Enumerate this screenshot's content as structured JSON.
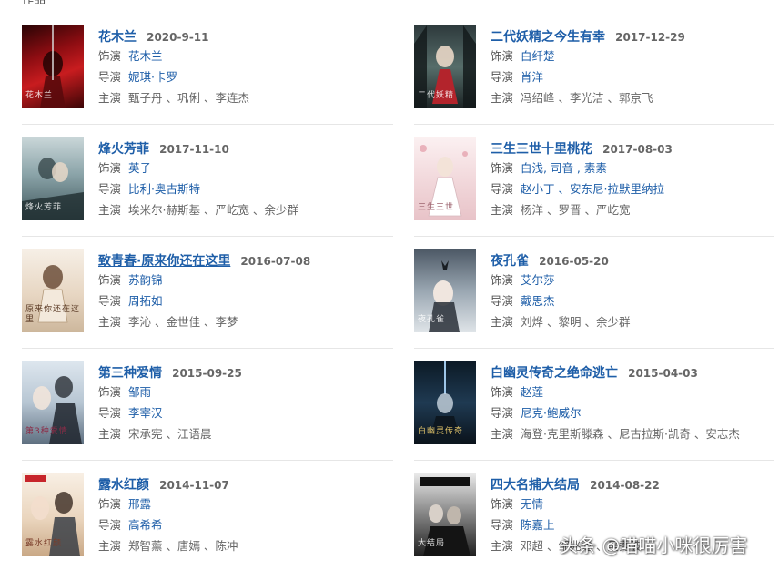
{
  "page": {
    "top_label": "作品"
  },
  "labels": {
    "role": "饰演",
    "director": "导演",
    "cast": "主演"
  },
  "colors": {
    "link": "#1e5ea8",
    "text": "#666666",
    "divider": "#e6e6e6"
  },
  "movies": [
    {
      "title": "花木兰",
      "date": "2020-9-11",
      "role": "花木兰",
      "director": "妮琪·卡罗",
      "cast": "甄子丹 、巩俐 、李连杰",
      "poster_icon": "poster-mulan",
      "poster_text": "花木兰"
    },
    {
      "title": "二代妖精之今生有幸",
      "date": "2017-12-29",
      "role": "白纤楚",
      "director": "肖洋",
      "cast": "冯绍峰 、李光洁 、郭京飞",
      "poster_icon": "poster-hanson",
      "poster_text": "二代妖精"
    },
    {
      "title": "烽火芳菲",
      "date": "2017-11-10",
      "role": "英子",
      "director": "比利·奥古斯特",
      "cast": "埃米尔·赫斯基 、严屹宽 、余少群",
      "poster_icon": "poster-fenghuo",
      "poster_text": "烽火芳菲"
    },
    {
      "title": "三生三世十里桃花",
      "date": "2017-08-03",
      "role": "白浅, 司音 , 素素",
      "director": "赵小丁 、安东尼·拉默里纳拉",
      "cast": "杨洋 、罗晋 、严屹宽",
      "poster_icon": "poster-sansheng",
      "poster_text": "三生三世"
    },
    {
      "title": "致青春·原来你还在这里",
      "date": "2016-07-08",
      "role": "苏韵锦",
      "director": "周拓如",
      "cast": "李沁 、金世佳 、李梦",
      "poster_icon": "poster-zhiqingchun",
      "poster_text": "原来你还在这里"
    },
    {
      "title": "夜孔雀",
      "date": "2016-05-20",
      "role": "艾尔莎",
      "director": "戴思杰",
      "cast": "刘烨 、黎明 、余少群",
      "poster_icon": "poster-yekongque",
      "poster_text": "夜孔雀"
    },
    {
      "title": "第三种爱情",
      "date": "2015-09-25",
      "role": "邹雨",
      "director": "李宰汉",
      "cast": "宋承宪 、江语晨",
      "poster_icon": "poster-disanzhong",
      "poster_text": "第3种爱情"
    },
    {
      "title": "白幽灵传奇之绝命逃亡",
      "date": "2015-04-03",
      "role": "赵莲",
      "director": "尼克·鲍威尔",
      "cast": "海登·克里斯滕森 、尼古拉斯·凯奇 、安志杰",
      "poster_icon": "poster-baiyouling",
      "poster_text": "白幽灵传奇"
    },
    {
      "title": "露水红颜",
      "date": "2014-11-07",
      "role": "邢露",
      "director": "高希希",
      "cast": "郑智薰 、唐嫣 、陈冲",
      "poster_icon": "poster-lushui",
      "poster_text": "露水红颜"
    },
    {
      "title": "四大名捕大结局",
      "date": "2014-08-22",
      "role": "无情",
      "director": "陈嘉上",
      "cast": "邓超 、邹兆龙 、吴秀波",
      "poster_icon": "poster-sidamingbu",
      "poster_text": "大结局"
    }
  ],
  "watermark": "头条 @喵喵小咪很厉害"
}
